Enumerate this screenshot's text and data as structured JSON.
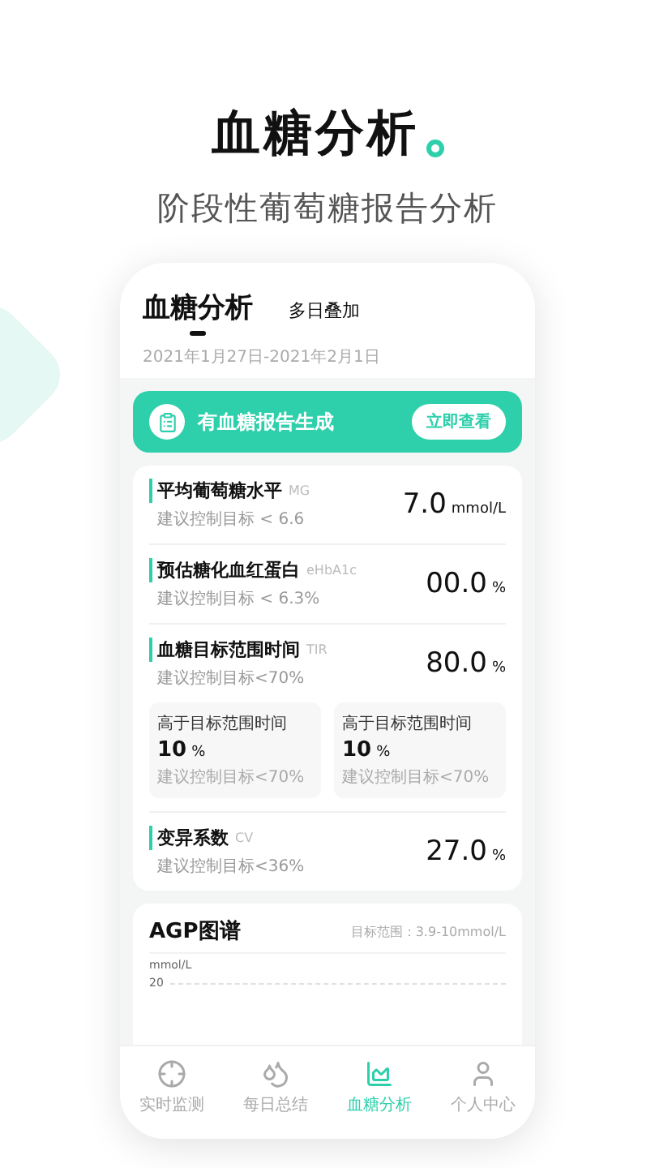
{
  "headline": {
    "title": "血糖分析",
    "subtitle": "阶段性葡萄糖报告分析"
  },
  "tabs": [
    {
      "label": "血糖分析",
      "selected": true
    },
    {
      "label": "多日叠加",
      "selected": false
    }
  ],
  "date_range": "2021年1月27日-2021年2月1日",
  "banner": {
    "text": "有血糖报告生成",
    "button": "立即查看"
  },
  "metrics": [
    {
      "title": "平均葡萄糖水平",
      "tag": "MG",
      "hint": "建议控制目标 < 6.6",
      "value": "7.0",
      "unit": "mmol/L"
    },
    {
      "title": "预估糖化血红蛋白",
      "tag": "eHbA1c",
      "hint": "建议控制目标 < 6.3%",
      "value": "00.0",
      "unit": "%"
    },
    {
      "title": "血糖目标范围时间",
      "tag": "TIR",
      "hint": "建议控制目标<70%",
      "value": "80.0",
      "unit": "%",
      "sub_cards": [
        {
          "label": "高于目标范围时间",
          "value": "10",
          "unit": "%",
          "hint": "建议控制目标<70%"
        },
        {
          "label": "高于目标范围时间",
          "value": "10",
          "unit": "%",
          "hint": "建议控制目标<70%"
        }
      ]
    },
    {
      "title": "变异系数",
      "tag": "CV",
      "hint": "建议控制目标<36%",
      "value": "27.0",
      "unit": "%"
    }
  ],
  "agp": {
    "title": "AGP图谱",
    "range": "目标范围：3.9-10mmol/L",
    "axis_unit": "mmol/L",
    "axis_tick": "20"
  },
  "nav": [
    {
      "label": "实时监测",
      "selected": false
    },
    {
      "label": "每日总结",
      "selected": false
    },
    {
      "label": "血糖分析",
      "selected": true
    },
    {
      "label": "个人中心",
      "selected": false
    }
  ]
}
